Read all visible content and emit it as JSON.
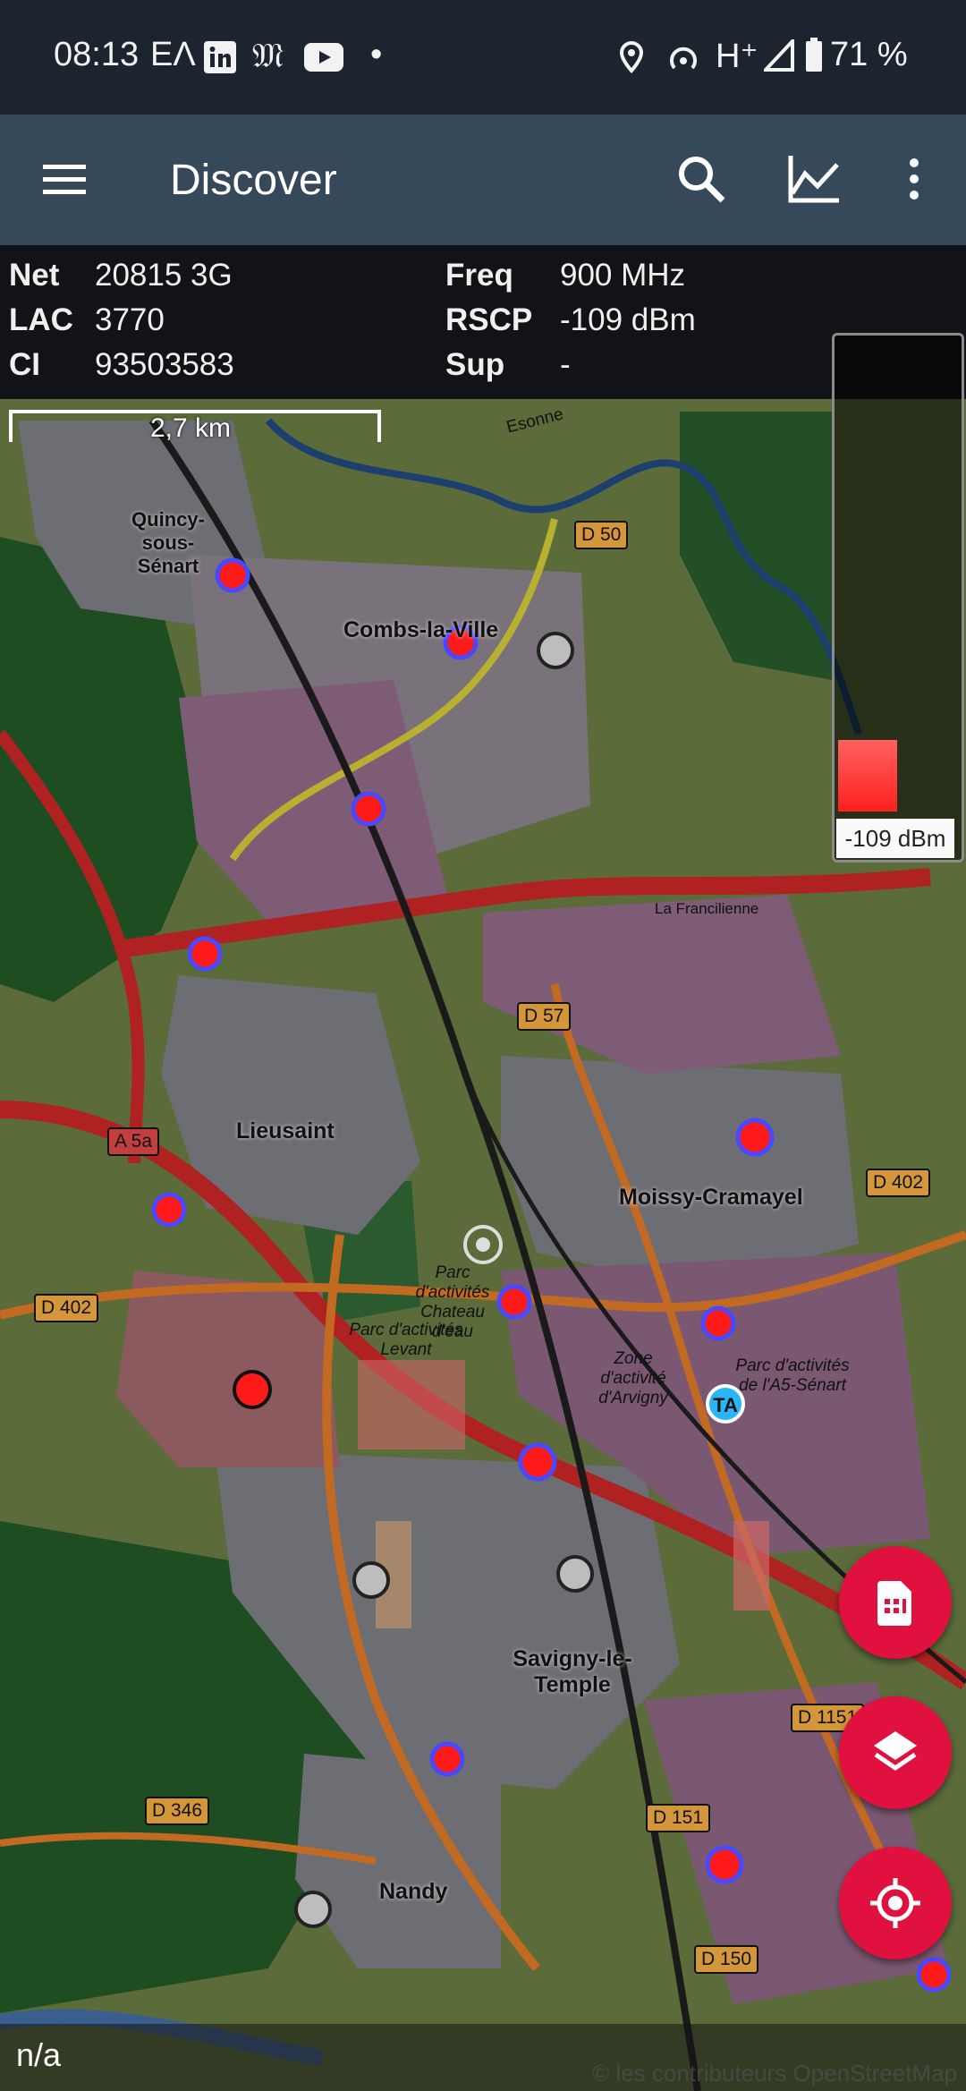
{
  "statusbar": {
    "time": "08:13",
    "left_extra": "ΕΛ",
    "battery": "71 %",
    "network": "H⁺"
  },
  "toolbar": {
    "title": "Discover",
    "menu_icon": "hamburger-menu-icon",
    "search_icon": "search-icon",
    "chart_icon": "line-chart-icon",
    "overflow_icon": "more-vert-icon"
  },
  "info": {
    "net_label": "Net",
    "net_value": "20815  3G",
    "lac_label": "LAC",
    "lac_value": "3770",
    "ci_label": "CI",
    "ci_value": "93503583",
    "freq_label": "Freq",
    "freq_value": "900 MHz",
    "rscp_label": "RSCP",
    "rscp_value": "-109 dBm",
    "sup_label": "Sup",
    "sup_value": "-"
  },
  "map": {
    "scale_label": "2,7 km",
    "legend_value": "-109 dBm",
    "places": [
      "Quincy-sous-Sénart",
      "Combs-la-Ville",
      "Lieusaint",
      "Moissy-Cramayel",
      "Savigny-le-Temple",
      "Nandy",
      "Parc d'activités Chateau d'eau",
      "Parc d'activités Levant",
      "Zone d'activité d'Arvigny",
      "Parc d'activités de l'A5-Sénart",
      "La Francilienne",
      "Esonne"
    ],
    "roads": [
      "D 50",
      "D 57",
      "A 5a",
      "D 402",
      "D 402",
      "D 346",
      "D 151",
      "D 150",
      "D 1151"
    ]
  },
  "bottom": {
    "status": "n/a",
    "attribution": "© les contributeurs OpenStreetMap"
  },
  "colors": {
    "toolbar": "#35495a",
    "fab": "#e0103f",
    "marker_fill": "#ff1a1a",
    "marker_ring": "#4848ff",
    "grey_marker": "#bdbdbd"
  }
}
